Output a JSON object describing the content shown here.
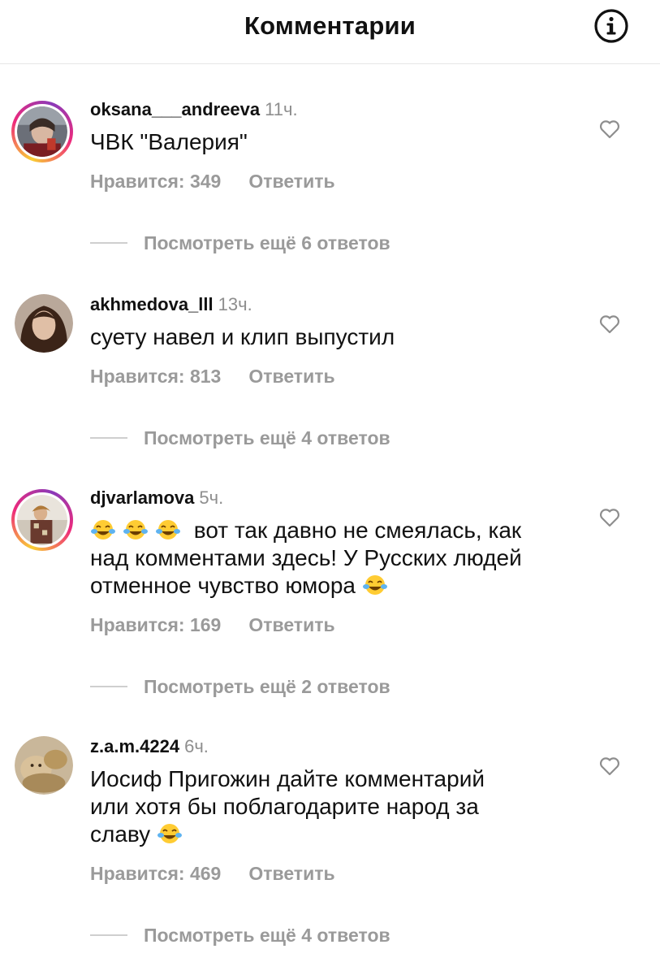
{
  "header": {
    "title": "Комментарии",
    "info_icon": "info-circle-icon"
  },
  "comments": [
    {
      "username": "oksana___andreeva",
      "time": "11ч.",
      "text": "ЧВК \"Валерия\"",
      "likes_label": "Нравится: 349",
      "reply_label": "Ответить",
      "view_replies": "Посмотреть ещё 6 ответов",
      "story_ring": true
    },
    {
      "username": "akhmedova_lll",
      "time": "13ч.",
      "text": "суету навел и клип выпустил",
      "likes_label": "Нравится: 813",
      "reply_label": "Ответить",
      "view_replies": "Посмотреть ещё 4 ответов",
      "story_ring": false
    },
    {
      "username": "djvarlamova",
      "time": "5ч.",
      "text_parts": [
        "вот так давно не смеялась, как",
        "над комментами здесь! У Русских людей",
        "отменное чувство юмора"
      ],
      "likes_label": "Нравится: 169",
      "reply_label": "Ответить",
      "view_replies": "Посмотреть ещё 2 ответов",
      "story_ring": true
    },
    {
      "username": "z.a.m.4224",
      "time": "6ч.",
      "text_parts": [
        "Иосиф Пригожин дайте комментарий",
        "или хотя бы поблагодарите народ за",
        "славу"
      ],
      "likes_label": "Нравится: 469",
      "reply_label": "Ответить",
      "view_replies": "Посмотреть ещё 4 ответов",
      "story_ring": false
    }
  ],
  "icons": {
    "like": "heart-outline-icon",
    "emoji": "face-with-tears-of-joy-icon"
  }
}
